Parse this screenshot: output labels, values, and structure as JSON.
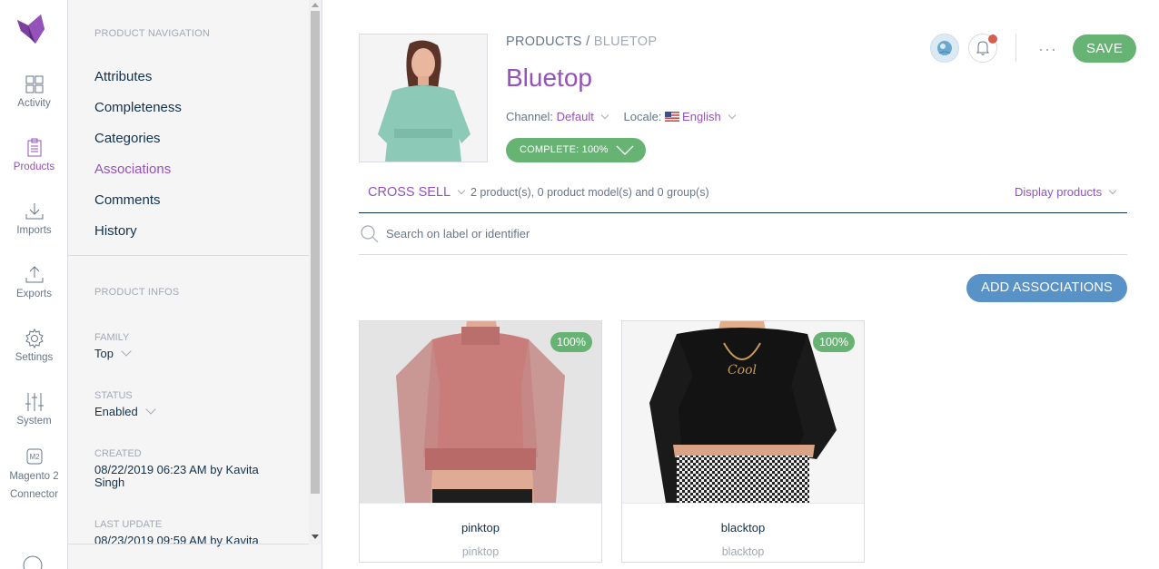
{
  "menu": {
    "items": [
      {
        "label": "Activity",
        "icon": "activity-icon"
      },
      {
        "label": "Products",
        "icon": "products-icon"
      },
      {
        "label": "Imports",
        "icon": "imports-icon"
      },
      {
        "label": "Exports",
        "icon": "exports-icon"
      },
      {
        "label": "Settings",
        "icon": "settings-icon"
      },
      {
        "label": "System",
        "icon": "system-icon"
      },
      {
        "label": "Magento 2",
        "label2": "Connector",
        "icon": "m2-connector-icon"
      }
    ],
    "active": "Products"
  },
  "product_nav": {
    "title": "PRODUCT NAVIGATION",
    "links": [
      "Attributes",
      "Completeness",
      "Categories",
      "Associations",
      "Comments",
      "History"
    ],
    "active": "Associations"
  },
  "product_infos": {
    "title": "PRODUCT INFOS",
    "family_label": "FAMILY",
    "family_value": "Top",
    "status_label": "STATUS",
    "status_value": "Enabled",
    "created_label": "CREATED",
    "created_value": "08/22/2019 06:23 AM by Kavita Singh",
    "updated_label": "LAST UPDATE",
    "updated_value": "08/23/2019 09:59 AM by Kavita"
  },
  "header": {
    "breadcrumb_root": "PRODUCTS",
    "breadcrumb_sep": " / ",
    "breadcrumb_current": "BLUETOP",
    "title": "Bluetop",
    "channel_label": "Channel:",
    "channel_value": "Default",
    "locale_label": "Locale:",
    "locale_value": "English",
    "complete_badge": "COMPLETE: 100%",
    "save_label": "SAVE",
    "more_label": "···"
  },
  "associations": {
    "type": "CROSS SELL",
    "count_text": "2 product(s), 0 product model(s) and 0 group(s)",
    "display_label": "Display products",
    "search_placeholder": "Search on label or identifier",
    "add_label": "ADD ASSOCIATIONS",
    "cards": [
      {
        "label": "pinktop",
        "identifier": "pinktop",
        "completeness": "100%"
      },
      {
        "label": "blacktop",
        "identifier": "blacktop",
        "completeness": "100%"
      }
    ]
  },
  "colors": {
    "accent": "#9452ba",
    "green": "#67b373",
    "blue": "#5992c7",
    "text": "#11324d"
  }
}
